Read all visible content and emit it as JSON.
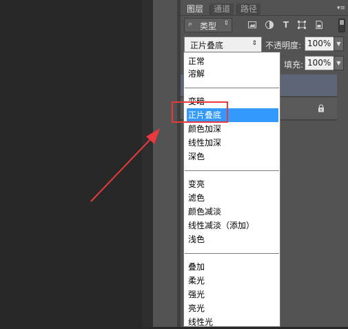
{
  "panel": {
    "tabs": [
      {
        "label": "图层",
        "active": true
      },
      {
        "label": "通道",
        "active": false
      },
      {
        "label": "路径",
        "active": false
      }
    ],
    "menu_icon": "panel-menu-icon",
    "filter": {
      "search_icon": "search-icon",
      "label": "类型",
      "icons": [
        "image-filter-icon",
        "adjustment-filter-icon",
        "type-filter-icon",
        "shape-filter-icon",
        "smart-object-filter-icon"
      ]
    },
    "blend_mode": {
      "value": "正片叠底"
    },
    "opacity": {
      "label": "不透明度:",
      "value": "100%"
    },
    "fill": {
      "label": "填充:",
      "value": "100%"
    },
    "colors": {
      "panel_bg": "#535353",
      "selected_layer": "#5c6677",
      "menu_highlight": "#3399ff",
      "annotation": "#e8393c"
    }
  },
  "dropdown": {
    "groups": [
      [
        "正常",
        "溶解"
      ],
      [
        "变暗",
        "正片叠底",
        "颜色加深",
        "线性加深",
        "深色"
      ],
      [
        "变亮",
        "滤色",
        "颜色减淡",
        "线性减淡（添加）",
        "浅色"
      ],
      [
        "叠加",
        "柔光",
        "强光",
        "亮光",
        "线性光"
      ]
    ],
    "selected": "正片叠底"
  }
}
